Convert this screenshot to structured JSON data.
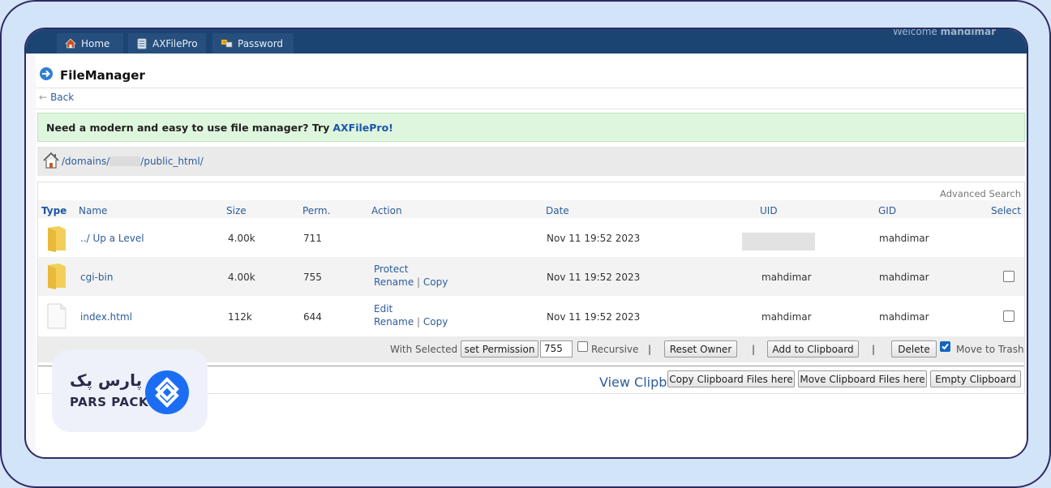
{
  "nav": {
    "tabs": [
      {
        "label": "Home",
        "icon": "home-icon"
      },
      {
        "label": "AXFilePro",
        "icon": "server-icon"
      },
      {
        "label": "Password",
        "icon": "keys-icon"
      }
    ],
    "welcome_prefix": "Welcome",
    "welcome_user": "mahdimar"
  },
  "header": {
    "title": "FileManager",
    "back_label": "Back"
  },
  "promo": {
    "text": "Need a modern and easy to use file manager? Try",
    "link": "AXFilePro!"
  },
  "path": {
    "seg1": "/domains/",
    "seg2": "/public_html/"
  },
  "table": {
    "advanced_search": "Advanced Search",
    "columns": {
      "type": "Type",
      "name": "Name",
      "size": "Size",
      "perm": "Perm.",
      "action": "Action",
      "date": "Date",
      "uid": "UID",
      "gid": "GID",
      "select": "Select"
    },
    "rows": [
      {
        "name": "../ Up a Level",
        "size": "4.00k",
        "perm": "711",
        "date": "Nov 11 19:52 2023",
        "uid": "",
        "gid": "mahdimar",
        "icon": "folder-icon"
      },
      {
        "name": "cgi-bin",
        "size": "4.00k",
        "perm": "755",
        "action1": "Protect",
        "action2": "Rename",
        "action3": "Copy",
        "date": "Nov 11 19:52 2023",
        "uid": "mahdimar",
        "gid": "mahdimar",
        "icon": "folder-icon"
      },
      {
        "name": "index.html",
        "size": "112k",
        "perm": "644",
        "action1": "Edit",
        "action2": "Rename",
        "action3": "Copy",
        "date": "Nov 11 19:52 2023",
        "uid": "mahdimar",
        "gid": "mahdimar",
        "icon": "file-icon"
      }
    ],
    "action_separator": "|"
  },
  "actions": {
    "with_selected": "With Selected",
    "set_permission": "set Permission",
    "permission_value": "755",
    "recursive": "Recursive",
    "reset_owner": "Reset Owner",
    "add_clipboard": "Add to Clipboard",
    "delete": "Delete",
    "move_trash": "Move to Trash",
    "separator": "|"
  },
  "clipboard": {
    "view": "View Clipboard",
    "copy_here": "Copy Clipboard Files here",
    "move_here": "Move Clipboard Files here",
    "empty": "Empty Clipboard"
  },
  "watermark": {
    "brand_fa": "پارس پک",
    "brand_en": "PARS PACK"
  },
  "colors": {
    "topbar": "#1c4473",
    "link": "#2d5c9a",
    "promo_bg": "#dff6de",
    "frame": "#2f2a66",
    "brand": "#1b6ef3"
  }
}
